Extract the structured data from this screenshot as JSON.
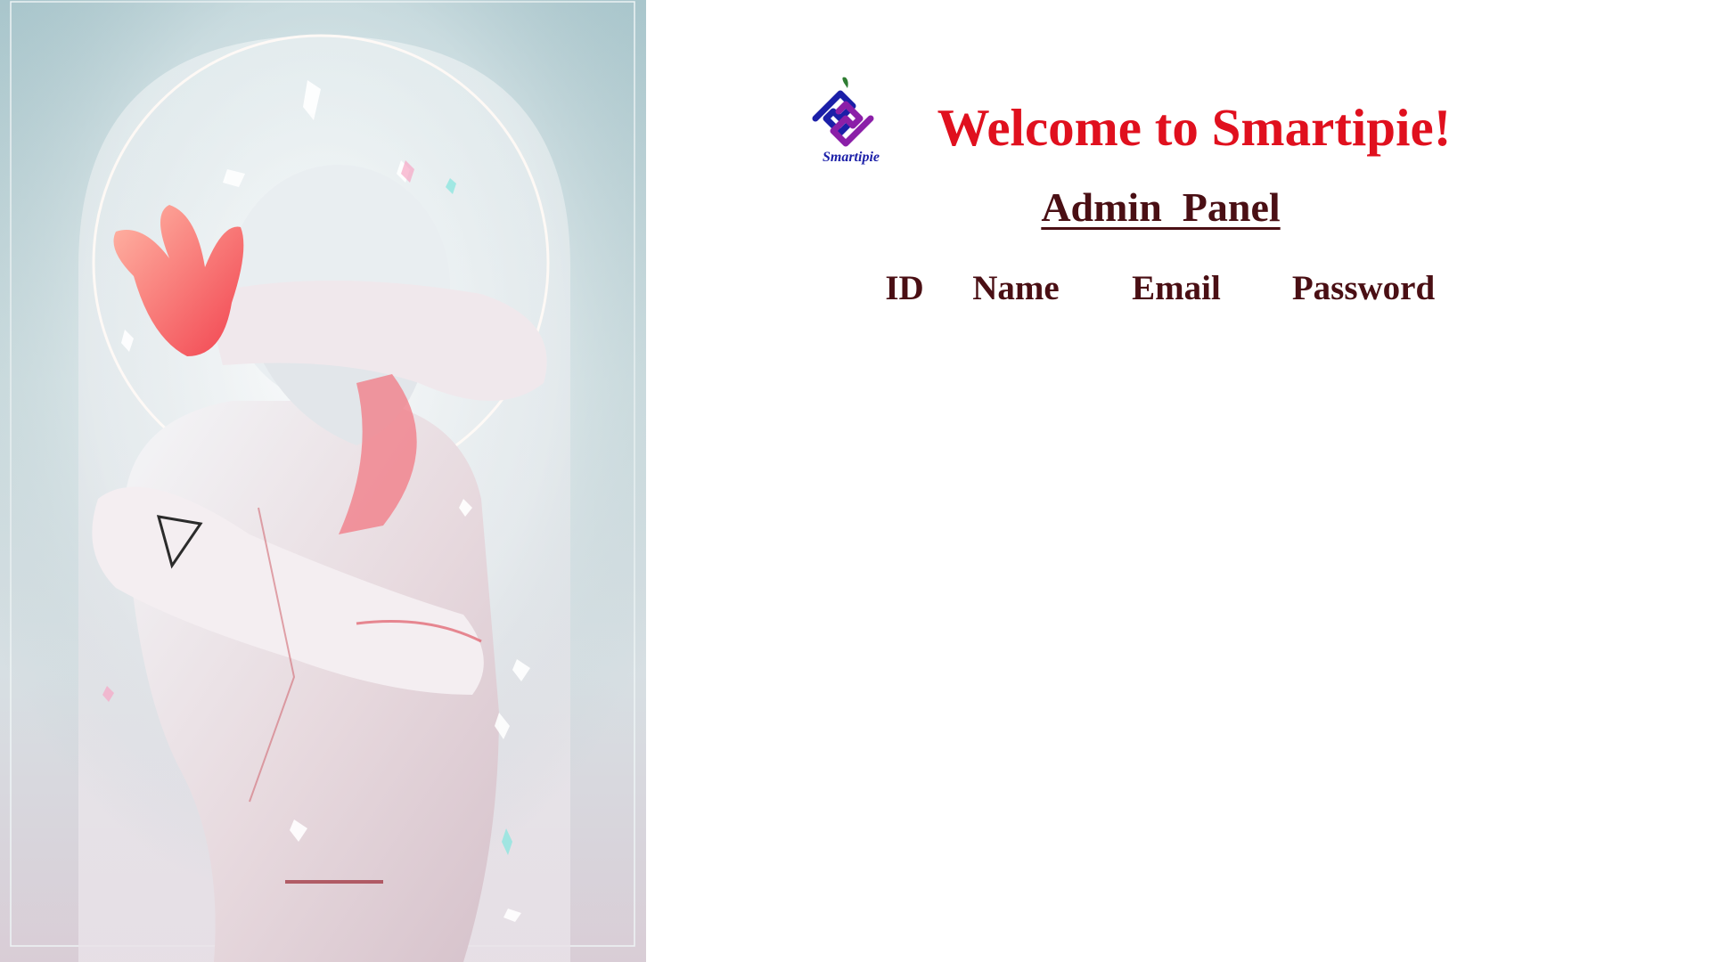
{
  "brand": {
    "logo_text": "Smartipie",
    "colors": {
      "logo_blue": "#1b1fa8",
      "logo_purple": "#8b1fa8",
      "leaf_green": "#2e7d32"
    }
  },
  "header": {
    "welcome": "Welcome to Smartipie!",
    "welcome_color": "#e0101e",
    "subtitle": "Admin  Panel",
    "subtitle_color": "#4a0f14"
  },
  "table": {
    "columns": [
      "ID",
      "Name",
      "Email",
      "Password"
    ],
    "rows": []
  },
  "hero_image": {
    "description_icon": "robot-figure-illustration"
  }
}
